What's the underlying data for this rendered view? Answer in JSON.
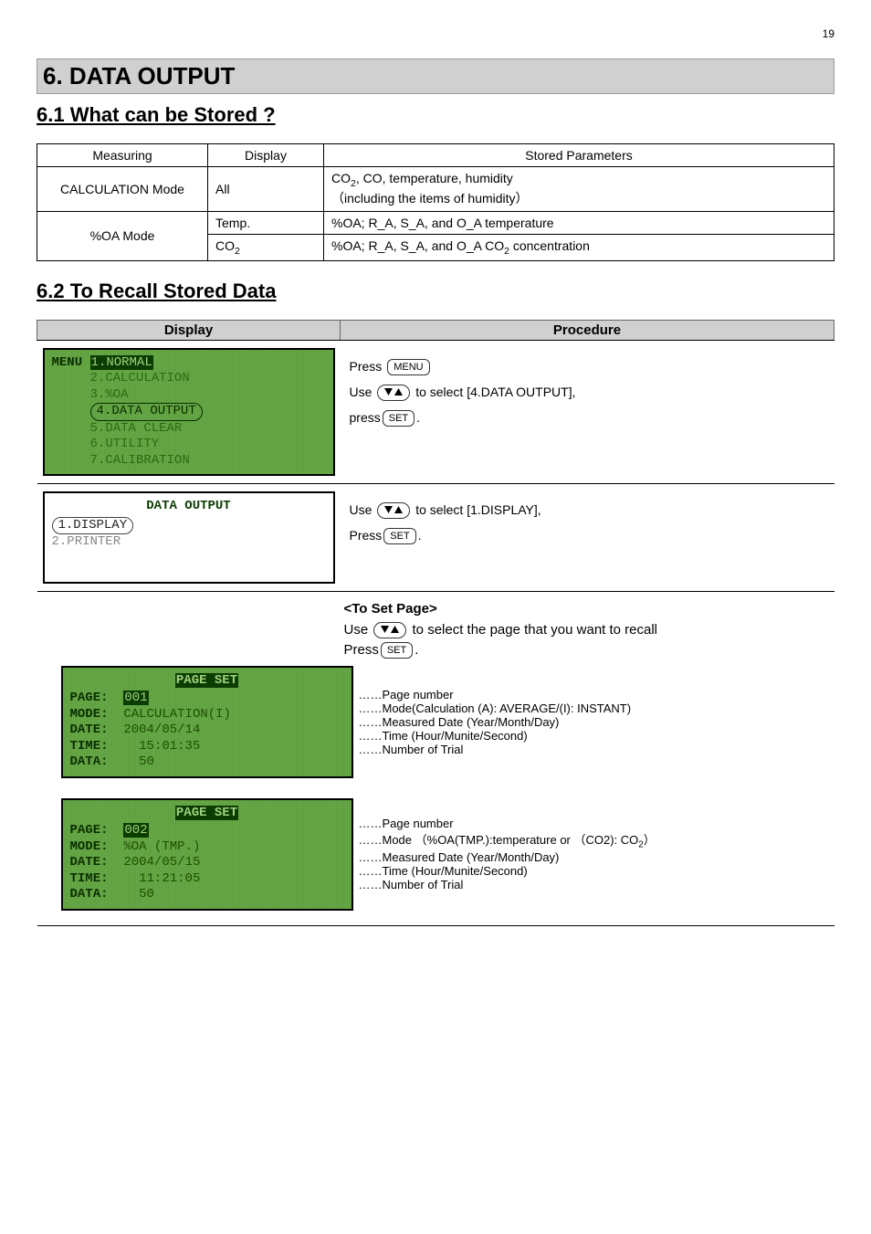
{
  "page_number": "19",
  "section_title": "6. DATA OUTPUT",
  "sub1_title": "6.1 What can be Stored ?",
  "table1": {
    "h1": "Measuring",
    "h2": "Display",
    "h3": "Stored Parameters",
    "r1c1": "CALCULATION Mode",
    "r1c2": "All",
    "r1c3a": "CO",
    "r1c3b": ", CO, temperature, humidity",
    "r1c3c": "（including the items of humidity）",
    "r2c1": "%OA Mode",
    "r2c2": "Temp.",
    "r2c3": "%OA; R_A, S_A, and O_A temperature",
    "r3c2": "CO",
    "r3c3a": "%OA; R_A, S_A, and O_A CO",
    "r3c3b": " concentration"
  },
  "sub2_title": "6.2 To Recall Stored Data",
  "proc": {
    "h_display": "Display",
    "h_procedure": "Procedure"
  },
  "proc1": {
    "lcd": {
      "l0": "MENU",
      "l1": "1.NORMAL",
      "l2": "2.CALCULATION",
      "l3": "3.%OA",
      "l4": "4.DATA OUTPUT",
      "l5": "5.DATA CLEAR",
      "l6": "6.UTILITY",
      "l7": "7.CALIBRATION"
    },
    "press": "Press ",
    "menu_btn": "MENU",
    "use": "Use ",
    "to_select": " to select [4.DATA OUTPUT],",
    "press2": "press",
    "set_btn": "SET",
    "dot": "."
  },
  "proc2": {
    "lcd": {
      "title": "DATA OUTPUT",
      "l1": "1.DISPLAY",
      "l2": "2.PRINTER"
    },
    "use": "Use ",
    "to_select": " to select [1.DISPLAY],",
    "press": "Press",
    "set_btn": "SET",
    "dot": "."
  },
  "proc3": {
    "heading": "<To Set Page>",
    "use": "Use ",
    "to_select": " to select the page that you want to recall",
    "press": "Press",
    "set_btn": "SET",
    "dot": ".",
    "lcd1": {
      "title": "PAGE SET",
      "r1l": "PAGE:",
      "r1v": "001",
      "r2l": "MODE:",
      "r2v": "CALCULATION(I)",
      "r3l": "DATE:",
      "r3v": "2004/05/14",
      "r4l": "TIME:",
      "r4v": "15:01:35",
      "r5l": "DATA:",
      "r5v": "50"
    },
    "notes1": {
      "n1": "……Page number",
      "n2": "……Mode(Calculation (A): AVERAGE/(I): INSTANT)",
      "n3": "……Measured Date (Year/Month/Day)",
      "n4": "……Time (Hour/Munite/Second)",
      "n5": "……Number of Trial"
    },
    "lcd2": {
      "title": "PAGE SET",
      "r1l": "PAGE:",
      "r1v": "002",
      "r2l": "MODE:",
      "r2v": "%OA (TMP.)",
      "r3l": "DATE:",
      "r3v": "2004/05/15",
      "r4l": "TIME:",
      "r4v": "11:21:05",
      "r5l": "DATA:",
      "r5v": "50"
    },
    "notes2": {
      "n1": "……Page number",
      "n2a": "……Mode （%OA(TMP.):temperature or （CO2): CO",
      "n2b": "）",
      "n3": "……Measured Date (Year/Month/Day)",
      "n4": "……Time (Hour/Munite/Second)",
      "n5": "……Number of Trial"
    }
  }
}
